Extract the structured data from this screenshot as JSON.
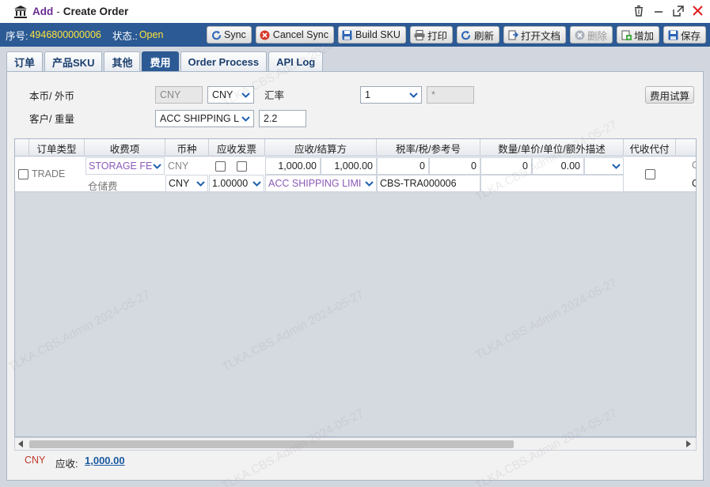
{
  "window": {
    "mode": "Add",
    "separator": "-",
    "title": "Create Order"
  },
  "header": {
    "serial_label": "序号:",
    "serial_value": "4946800000006",
    "status_label": "状态.:",
    "status_value": "Open"
  },
  "toolbar": {
    "sync": "Sync",
    "cancel_sync": "Cancel Sync",
    "build_sku": "Build SKU",
    "print": "打印",
    "refresh": "刷新",
    "open_doc": "打开文档",
    "delete": "删除",
    "add": "增加",
    "save": "保存"
  },
  "tabs": [
    "订单",
    "产品SKU",
    "其他",
    "费用",
    "Order Process",
    "API Log"
  ],
  "active_tab": "费用",
  "form": {
    "currency_label": "本币/ 外币",
    "base_currency": "CNY",
    "foreign_currency": "CNY",
    "rate_label": "汇率",
    "rate_select": "1",
    "rate_extra": "*",
    "calc_button": "费用试算",
    "customer_label": "客户/ 重量",
    "customer": "ACC SHIPPING L",
    "weight": "2.2"
  },
  "grid": {
    "headers": [
      "订单类型",
      "收费项",
      "币种",
      "应收发票",
      "应收/结算方",
      "税率/税/参考号",
      "数量/单价/单位/额外描述",
      "代收代付"
    ],
    "row": {
      "order_type": "TRADE",
      "charge_item": "STORAGE FE",
      "charge_item_cn": "仓储费",
      "currency_top": "CNY",
      "currency_bottom": "CNY",
      "invoice_rate": "1.00000",
      "amount1": "1,000.00",
      "amount2": "1,000.00",
      "party": "ACC SHIPPING LIMI",
      "tax_rate": "0",
      "tax": "0",
      "ref_no": "CBS-TRA000006",
      "qty": "0",
      "unit_price": "0.00",
      "extra_top": "O",
      "extra_bottom": "O"
    }
  },
  "footer": {
    "currency": "CNY",
    "receivable_label": "应收:",
    "receivable_value": "1,000.00"
  },
  "watermark": "TLKA.CBS.Admin 2024-05-27"
}
